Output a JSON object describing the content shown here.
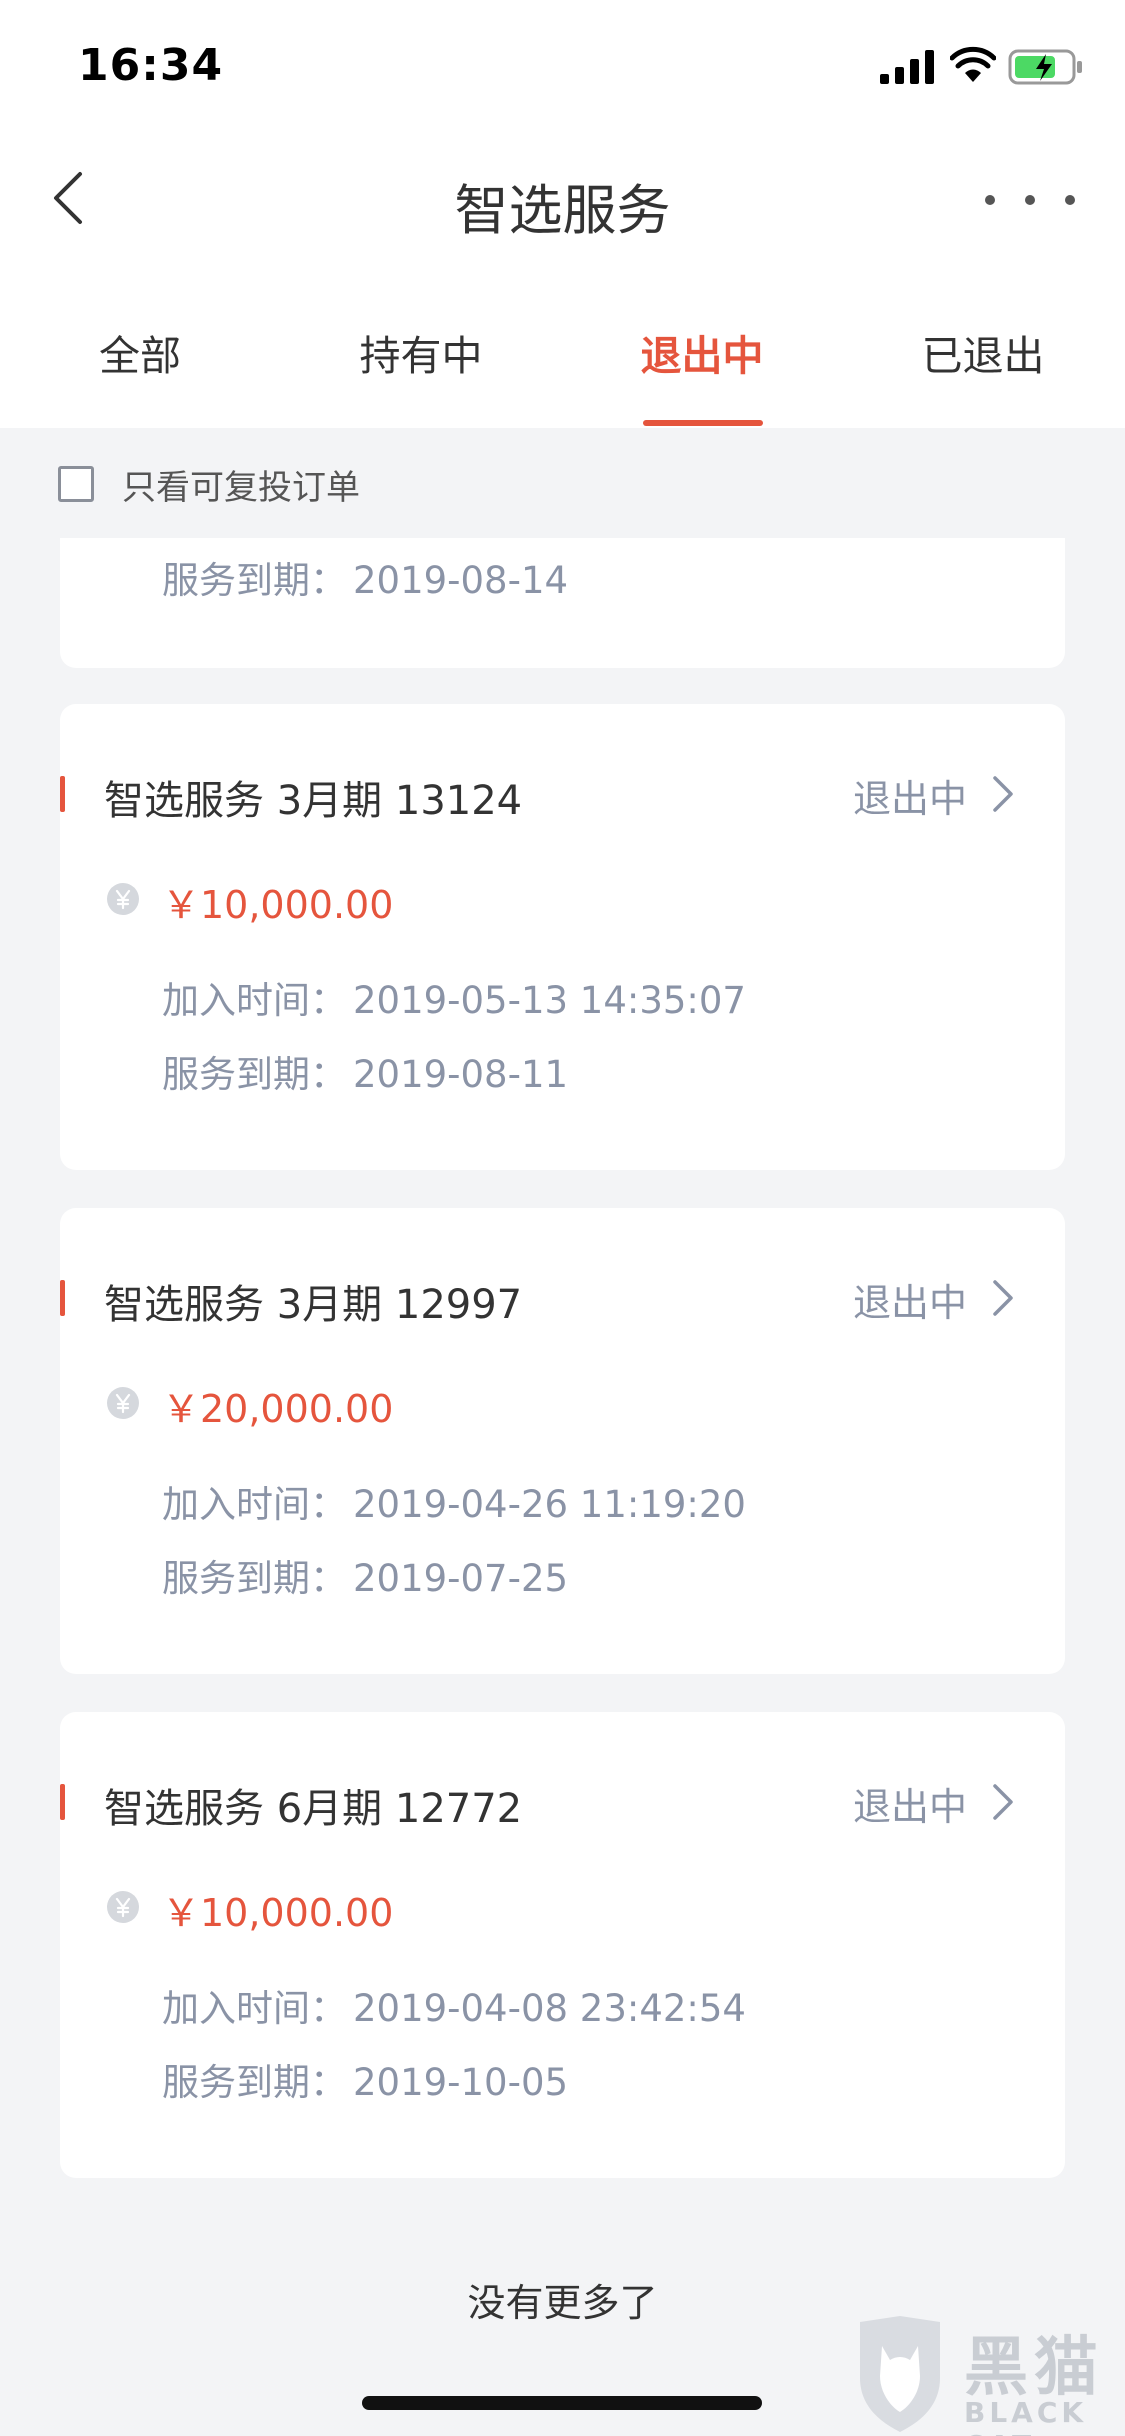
{
  "status_bar": {
    "time": "16:34"
  },
  "header": {
    "title": "智选服务"
  },
  "tabs": [
    {
      "label": "全部",
      "active": false
    },
    {
      "label": "持有中",
      "active": false
    },
    {
      "label": "退出中",
      "active": true
    },
    {
      "label": "已退出",
      "active": false
    }
  ],
  "filter": {
    "label": "只看可复投订单",
    "checked": false
  },
  "partial_card": {
    "expire_label": "服务到期：",
    "expire_value": "2019-08-14"
  },
  "orders": [
    {
      "title": "智选服务 3月期 13124",
      "status": "退出中",
      "amount": "￥10,000.00",
      "join_label": "加入时间：",
      "join_value": "2019-05-13 14:35:07",
      "expire_label": "服务到期：",
      "expire_value": "2019-08-11"
    },
    {
      "title": "智选服务 3月期 12997",
      "status": "退出中",
      "amount": "￥20,000.00",
      "join_label": "加入时间：",
      "join_value": "2019-04-26 11:19:20",
      "expire_label": "服务到期：",
      "expire_value": "2019-07-25"
    },
    {
      "title": "智选服务 6月期 12772",
      "status": "退出中",
      "amount": "￥10,000.00",
      "join_label": "加入时间：",
      "join_value": "2019-04-08 23:42:54",
      "expire_label": "服务到期：",
      "expire_value": "2019-10-05"
    }
  ],
  "footer": {
    "text": "没有更多了"
  },
  "watermark": {
    "cn": "黑猫",
    "en": "BLACK CAT"
  },
  "colors": {
    "accent": "#e5553d",
    "text_primary": "#333333",
    "text_secondary": "#8a93a6",
    "background": "#f3f4f6"
  },
  "icons": {
    "back": "chevron-left-icon",
    "more": "ellipsis-icon",
    "chevron": "chevron-right-icon",
    "coin": "yuan-coin-icon"
  }
}
